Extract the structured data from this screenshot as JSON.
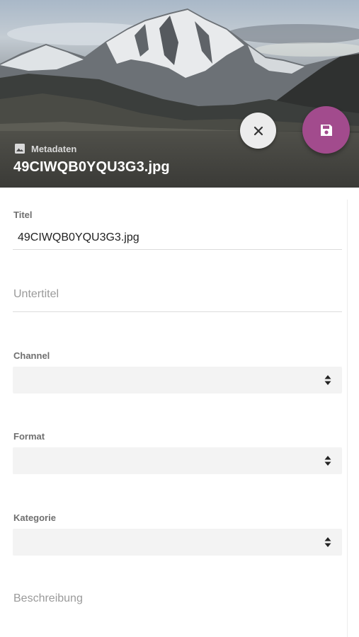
{
  "header": {
    "section_label": "Metadaten",
    "section_icon": "image-icon",
    "filename": "49CIWQB0YQU3G3.jpg"
  },
  "actions": {
    "close_icon": "close-icon",
    "save_icon": "save-icon",
    "save_color": "#a24b8d",
    "close_color": "#ececec"
  },
  "form": {
    "title": {
      "label": "Titel",
      "value": "49CIWQB0YQU3G3.jpg"
    },
    "subtitle": {
      "placeholder": "Untertitel"
    },
    "channel": {
      "label": "Channel",
      "value": ""
    },
    "format": {
      "label": "Format",
      "value": ""
    },
    "category": {
      "label": "Kategorie",
      "value": ""
    },
    "description": {
      "placeholder": "Beschreibung"
    }
  }
}
